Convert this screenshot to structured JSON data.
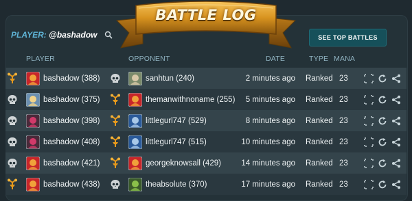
{
  "banner": {
    "title": "BATTLE LOG"
  },
  "player": {
    "label": "PLAYER:",
    "name": "@bashadow"
  },
  "buttons": {
    "top_battles": "SEE TOP BATTLES"
  },
  "columns": {
    "player": "PLAYER",
    "opponent": "OPPONENT",
    "date": "DATE",
    "type": "TYPE",
    "mana": "MANA"
  },
  "colors": {
    "win": "#e89a1c",
    "loss": "#cfd4d6",
    "accent": "#5fb4d6",
    "button": "#16505a"
  },
  "rows": [
    {
      "player_result": "win-icon",
      "player": "bashadow (388)",
      "player_avatar": "red-dragon-avatar",
      "opp_result": "skull-icon",
      "opponent": "sanhtun (240)",
      "opp_avatar": "old-man-avatar",
      "date": "2 minutes ago",
      "type": "Ranked",
      "mana": "23"
    },
    {
      "player_result": "skull-icon",
      "player": "bashadow (375)",
      "player_avatar": "blonde-avatar",
      "opp_result": "win-icon",
      "opponent": "themanwithnoname (255)",
      "opp_avatar": "red-dragon-avatar",
      "date": "5 minutes ago",
      "type": "Ranked",
      "mana": "23"
    },
    {
      "player_result": "skull-icon",
      "player": "bashadow (398)",
      "player_avatar": "dark-warrior-avatar",
      "opp_result": "win-icon",
      "opponent": "littlegurl747 (529)",
      "opp_avatar": "blue-knight-avatar",
      "date": "8 minutes ago",
      "type": "Ranked",
      "mana": "23"
    },
    {
      "player_result": "skull-icon",
      "player": "bashadow (408)",
      "player_avatar": "dark-warrior-avatar",
      "opp_result": "win-icon",
      "opponent": "littlegurl747 (515)",
      "opp_avatar": "blue-knight-avatar",
      "date": "10 minutes ago",
      "type": "Ranked",
      "mana": "23"
    },
    {
      "player_result": "skull-icon",
      "player": "bashadow (421)",
      "player_avatar": "red-dragon-avatar",
      "opp_result": "win-icon",
      "opponent": "georgeknowsall (429)",
      "opp_avatar": "red-dragon-avatar",
      "date": "14 minutes ago",
      "type": "Ranked",
      "mana": "23"
    },
    {
      "player_result": "win-icon",
      "player": "bashadow (438)",
      "player_avatar": "red-dragon-avatar",
      "opp_result": "skull-icon",
      "opponent": "theabsolute (370)",
      "opp_avatar": "goblin-avatar",
      "date": "17 minutes ago",
      "type": "Ranked",
      "mana": "23"
    }
  ]
}
